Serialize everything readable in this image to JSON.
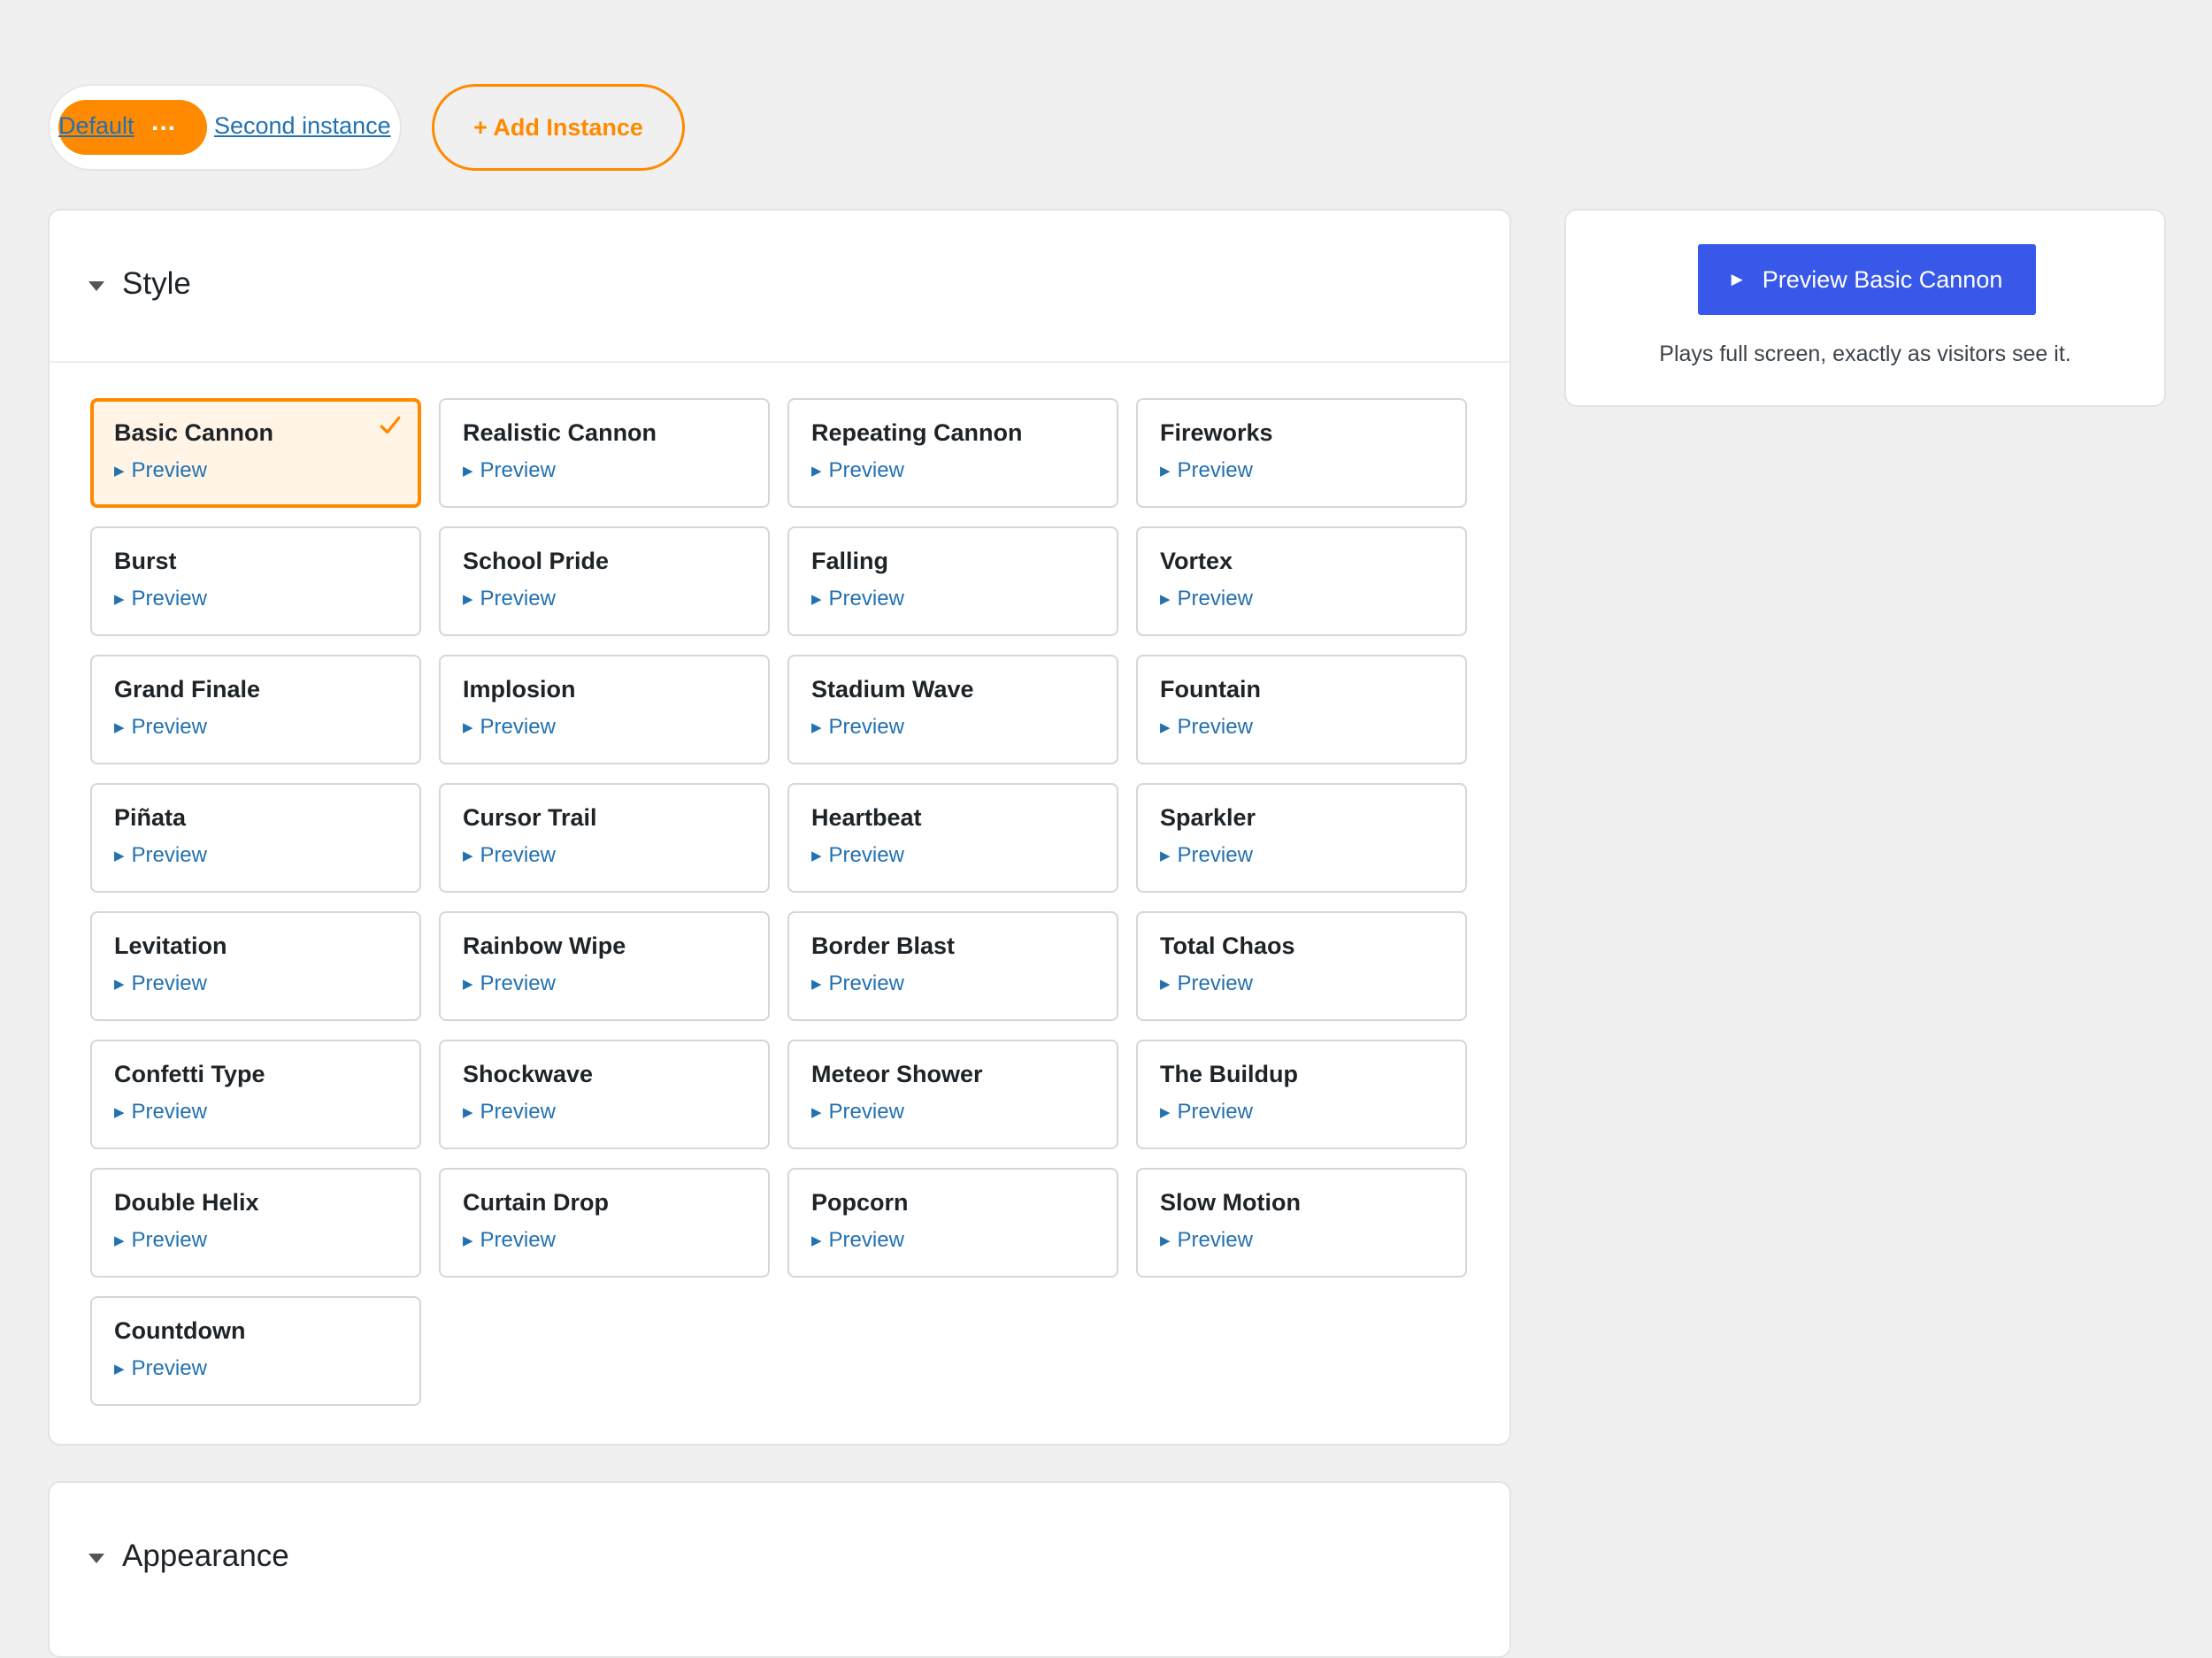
{
  "instances": {
    "tabs": [
      {
        "label": "Default",
        "menu_label": "...",
        "active": true
      },
      {
        "label": "Second instance",
        "active": false
      }
    ],
    "add_label": "+ Add Instance"
  },
  "style_section": {
    "title": "Style",
    "preview_link_label": "Preview",
    "selected": "Basic Cannon",
    "styles": [
      "Basic Cannon",
      "Realistic Cannon",
      "Repeating Cannon",
      "Fireworks",
      "Burst",
      "School Pride",
      "Falling",
      "Vortex",
      "Grand Finale",
      "Implosion",
      "Stadium Wave",
      "Fountain",
      "Piñata",
      "Cursor Trail",
      "Heartbeat",
      "Sparkler",
      "Levitation",
      "Rainbow Wipe",
      "Border Blast",
      "Total Chaos",
      "Confetti Type",
      "Shockwave",
      "Meteor Shower",
      "The Buildup",
      "Double Helix",
      "Curtain Drop",
      "Popcorn",
      "Slow Motion",
      "Countdown"
    ]
  },
  "appearance_section": {
    "title": "Appearance"
  },
  "preview_panel": {
    "button_label": "Preview Basic Cannon",
    "note": "Plays full screen, exactly as visitors see it."
  },
  "colors": {
    "accent": "#ff8a00",
    "link": "#2271b1",
    "primary_button": "#3858e9"
  },
  "icons": {
    "selected": "check-icon",
    "play": "play-icon",
    "collapse": "caret-down-icon",
    "menu": "ellipsis-icon"
  }
}
